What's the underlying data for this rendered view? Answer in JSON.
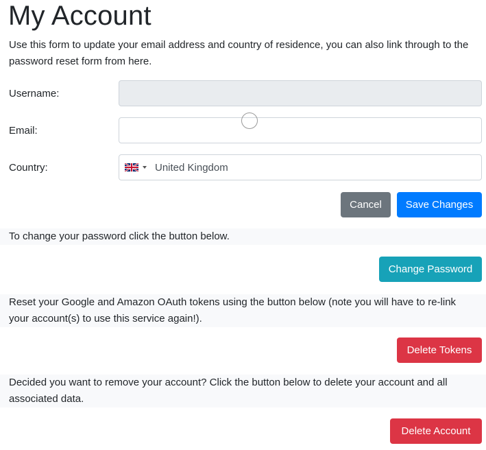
{
  "page": {
    "title": "My Account",
    "intro": "Use this form to update your email address and country of residence, you can also link through to the password reset form from here."
  },
  "form": {
    "username_label": "Username:",
    "username_value": "",
    "email_label": "Email:",
    "email_value": "",
    "country_label": "Country:",
    "country_value": "United Kingdom",
    "country_flag": "uk-flag-icon",
    "cancel_label": "Cancel",
    "save_label": "Save Changes"
  },
  "password_section": {
    "text": "To change your password click the button below.",
    "button_label": "Change Password"
  },
  "tokens_section": {
    "text": "Reset your Google and Amazon OAuth tokens using the button below (note you will have to re-link your account(s) to use this service again!).",
    "button_label": "Delete Tokens"
  },
  "delete_section": {
    "text": "Decided you want to remove your account? Click the button below to delete your account and all associated data.",
    "button_label": "Delete Account"
  },
  "colors": {
    "primary": "#007bff",
    "secondary": "#6c757d",
    "info": "#17a2b8",
    "danger": "#dc3545"
  }
}
